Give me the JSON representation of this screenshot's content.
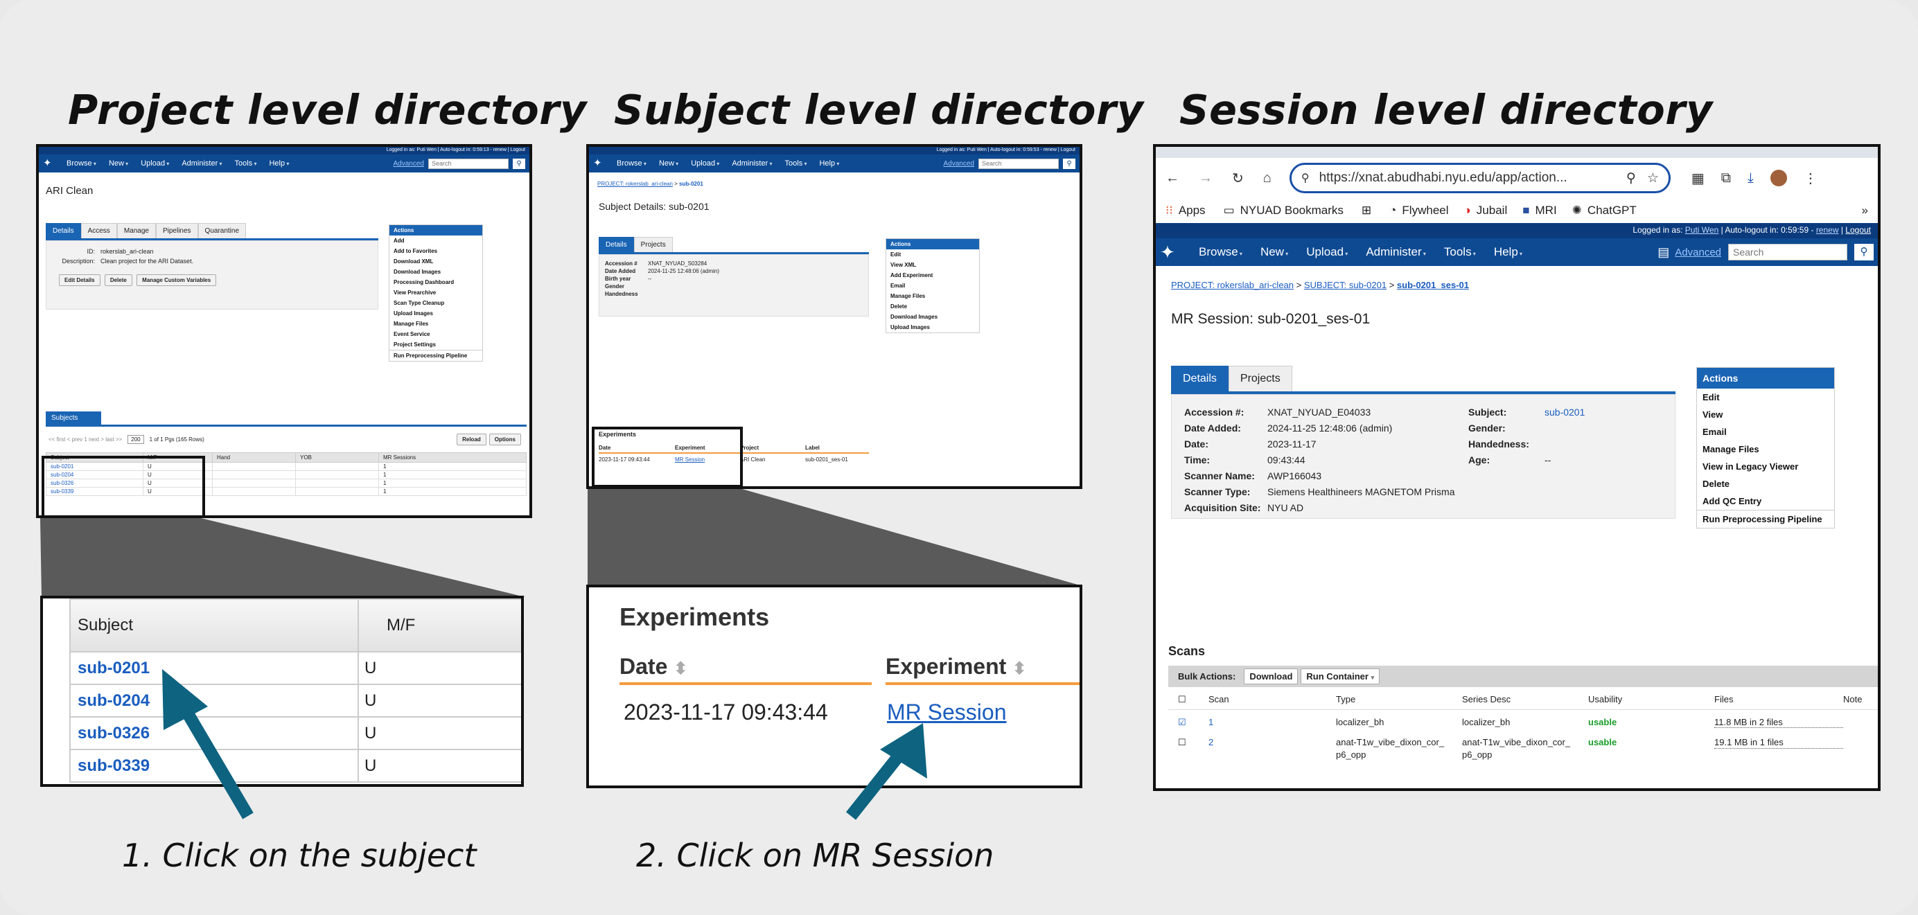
{
  "titles": {
    "project": "Project level directory",
    "subject": "Subject level directory",
    "session": "Session level directory"
  },
  "steps": {
    "one": "1. Click on the subject",
    "two": "2. Click on MR Session"
  },
  "colors": {
    "nav": "#0e4a92",
    "tabActive": "#1a64b4",
    "arrow": "#0d6380",
    "link": "#1a5dbf",
    "usable": "#1a9e2a",
    "orange": "#f39c3c"
  },
  "nav": {
    "items": [
      "Browse",
      "New",
      "Upload",
      "Administer",
      "Tools",
      "Help"
    ],
    "advanced": "Advanced",
    "search": "Search"
  },
  "project": {
    "login": "Logged in as: Puti Wen | Auto-logout in: 0:59:13 - renew | Logout",
    "name": "ARI Clean",
    "tabs": [
      "Details",
      "Access",
      "Manage",
      "Pipelines",
      "Quarantine"
    ],
    "id_label": "ID:",
    "id_value": "rokerslab_ari-clean",
    "desc_label": "Description:",
    "desc_value": "Clean project for the ARI Dataset.",
    "buttons": [
      "Edit Details",
      "Delete",
      "Manage Custom Variables"
    ],
    "actions_title": "Actions",
    "actions": [
      "Add",
      "Add to Favorites",
      "Download XML",
      "Download Images",
      "Processing Dashboard",
      "View Prearchive",
      "Scan Type Cleanup",
      "Upload Images",
      "Manage Files",
      "Event Service",
      "Project Settings",
      "Run Preprocessing Pipeline"
    ],
    "subjects_tab": "Subjects",
    "paging": "<< first  < prev   1   next >  last >>",
    "page_size": "200",
    "rows_info": "1 of 1 Pgs (165 Rows)",
    "reload": "Reload",
    "options": "Options",
    "cols": [
      "Subject",
      "M/F",
      "Hand",
      "YOB",
      "MR Sessions"
    ],
    "rows": [
      [
        "sub-0201",
        "U",
        "",
        "",
        "1"
      ],
      [
        "sub-0204",
        "U",
        "",
        "",
        "1"
      ],
      [
        "sub-0326",
        "U",
        "",
        "",
        "1"
      ],
      [
        "sub-0339",
        "U",
        "",
        "",
        "1"
      ]
    ]
  },
  "subject": {
    "login": "Logged in as: Puti Wen | Auto-logout in: 0:59:53 - renew | Logout",
    "crumb_project": "PROJECT: rokerslab_ari-clean",
    "crumb_sep": ">",
    "crumb_subject": "sub-0201",
    "heading": "Subject Details: sub-0201",
    "tabs": [
      "Details",
      "Projects"
    ],
    "fields": [
      [
        "Accession #",
        "XNAT_NYUAD_S03284"
      ],
      [
        "Date Added",
        "2024-11-25 12:48:06 (admin)"
      ],
      [
        "Birth year",
        "--"
      ],
      [
        "Gender",
        ""
      ],
      [
        "Handedness",
        ""
      ]
    ],
    "actions_title": "Actions",
    "actions": [
      "Edit",
      "View XML",
      "Add Experiment",
      "Email",
      "Manage Files",
      "Delete",
      "Download Images",
      "Upload Images"
    ],
    "exp_title": "Experiments",
    "exp_cols": [
      "Date",
      "Experiment",
      "Project",
      "Label"
    ],
    "exp_row": [
      "2023-11-17 09:43:44",
      "MR Session",
      "ARI Clean",
      "sub-0201_ses-01"
    ]
  },
  "session": {
    "url": "https://xnat.abudhabi.nyu.edu/app/action...",
    "bookmarks": [
      "Apps",
      "NYUAD Bookmarks",
      "Flywheel",
      "Jubail",
      "MRI",
      "ChatGPT"
    ],
    "login_prefix": "Logged in as:",
    "login_user": "Puti Wen",
    "autologout": "Auto-logout in: 0:59:59 -",
    "renew": "renew",
    "logout": "Logout",
    "crumb_project": "PROJECT: rokerslab_ari-clean",
    "crumb_subject": "SUBJECT: sub-0201",
    "crumb_session": "sub-0201_ses-01",
    "heading": "MR Session: sub-0201_ses-01",
    "tabs": [
      "Details",
      "Projects"
    ],
    "left_fields": [
      [
        "Accession #:",
        "XNAT_NYUAD_E04033"
      ],
      [
        "Date Added:",
        "2024-11-25 12:48:06 (admin)"
      ],
      [
        "Date:",
        "2023-11-17"
      ],
      [
        "Time:",
        "09:43:44"
      ],
      [
        "Scanner Name:",
        "AWP166043"
      ],
      [
        "Scanner Type:",
        "Siemens Healthineers MAGNETOM Prisma"
      ],
      [
        "Acquisition Site:",
        "NYU AD"
      ]
    ],
    "right_fields": [
      [
        "Subject:",
        "sub-0201"
      ],
      [
        "Gender:",
        ""
      ],
      [
        "Handedness:",
        ""
      ],
      [
        "Age:",
        "--"
      ]
    ],
    "actions_title": "Actions",
    "actions": [
      "Edit",
      "View",
      "Email",
      "Manage Files",
      "View in Legacy Viewer",
      "Delete",
      "Add QC Entry",
      "Run Preprocessing Pipeline"
    ],
    "scans_title": "Scans",
    "bulk_label": "Bulk Actions:",
    "download": "Download",
    "run_container": "Run Container",
    "scan_cols": [
      "Scan",
      "Type",
      "Series Desc",
      "Usability",
      "Files",
      "Note"
    ],
    "scans": [
      {
        "scan": "1",
        "type": "localizer_bh",
        "desc": "localizer_bh",
        "usability": "usable",
        "files": "11.8 MB in 2 files",
        "checked": true
      },
      {
        "scan": "2",
        "type": "anat-T1w_vibe_dixon_cor_p6_opp",
        "desc": "anat-T1w_vibe_dixon_cor_p6_opp",
        "usability": "usable",
        "files": "19.1 MB in 1 files",
        "checked": false
      }
    ]
  },
  "zoom1": {
    "cols": [
      "Subject",
      "M/F"
    ],
    "rows": [
      [
        "sub-0201",
        "U"
      ],
      [
        "sub-0204",
        "U"
      ],
      [
        "sub-0326",
        "U"
      ],
      [
        "sub-0339",
        "U"
      ]
    ]
  },
  "zoom2": {
    "title": "Experiments",
    "cols": [
      "Date",
      "Experiment"
    ],
    "date": "2023-11-17 09:43:44",
    "experiment": "MR Session"
  }
}
